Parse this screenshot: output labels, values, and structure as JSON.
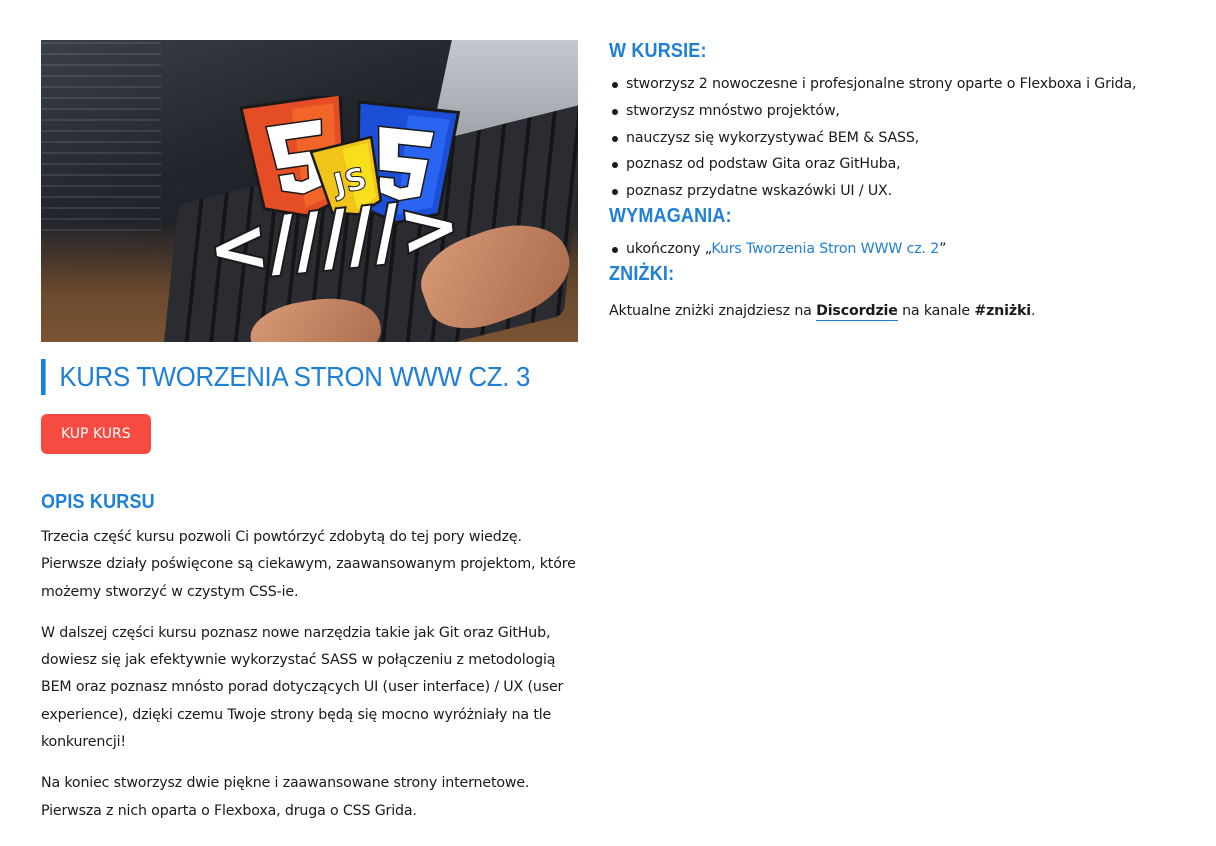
{
  "course": {
    "title": "KURS TWORZENIA STRON WWW CZ. 3",
    "buy_label": "KUP KURS"
  },
  "colors": {
    "accent": "#1e7fd8",
    "button": "#f64b41"
  },
  "opis": {
    "heading": "OPIS KURSU",
    "paragraphs": [
      "Trzecia część kursu pozwoli Ci powtórzyć zdobytą do tej pory wiedzę. Pierwsze działy poświęcone są ciekawym, zaawansowanym projektom, które możemy stworzyć w czystym CSS-ie.",
      "W dalszej części kursu poznasz nowe narzędzia takie jak Git oraz GitHub, dowiesz się jak efektywnie wykorzystać SASS w połączeniu z metodologią BEM oraz poznasz mnósto porad dotyczących UI (user interface) / UX (user experience), dzięki czemu Twoje strony będą się mocno wyróżniały na tle konkurencji!",
      "Na koniec stworzysz dwie piękne i zaawansowane strony internetowe. Pierwsza z nich oparta o Flexboxa, druga o CSS Grida."
    ]
  },
  "w_kursie": {
    "heading": "W KURSIE:",
    "items": [
      "stworzysz 2 nowoczesne i profesjonalne strony oparte o Flexboxa i Grida,",
      "stworzysz mnóstwo projektów,",
      "nauczysz się wykorzystywać BEM & SASS,",
      "poznasz od podstaw Gita oraz GitHuba,",
      "poznasz przydatne wskazówki UI / UX."
    ]
  },
  "wymagania": {
    "heading": "WYMAGANIA:",
    "prefix": "ukończony „",
    "link_text": "Kurs Tworzenia Stron WWW cz. 2",
    "suffix": "”"
  },
  "znizki": {
    "heading": "ZNIŻKI:",
    "text_before": "Aktualne zniżki znajdziesz na ",
    "discord_label": "Discordzie",
    "text_middle": " na kanale ",
    "channel": "#zniżki",
    "text_after": "."
  },
  "hero": {
    "icon": "html-css-js-logo",
    "logo_text": "</////>"
  }
}
